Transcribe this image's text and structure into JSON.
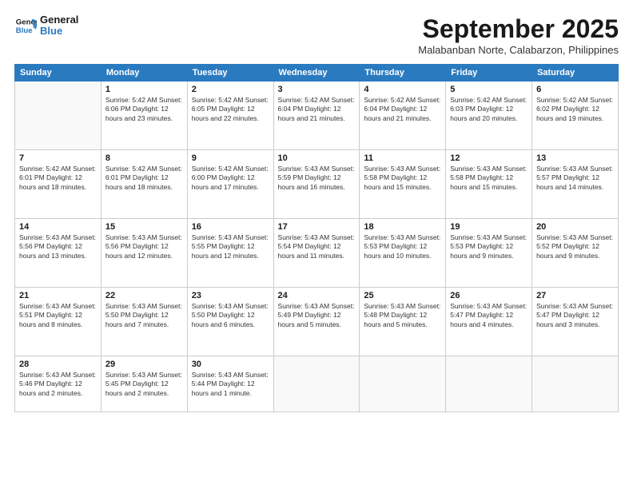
{
  "header": {
    "logo_line1": "General",
    "logo_line2": "Blue",
    "month_title": "September 2025",
    "location": "Malabanban Norte, Calabarzon, Philippines"
  },
  "days_of_week": [
    "Sunday",
    "Monday",
    "Tuesday",
    "Wednesday",
    "Thursday",
    "Friday",
    "Saturday"
  ],
  "weeks": [
    [
      {
        "day": "",
        "info": ""
      },
      {
        "day": "1",
        "info": "Sunrise: 5:42 AM\nSunset: 6:06 PM\nDaylight: 12 hours\nand 23 minutes."
      },
      {
        "day": "2",
        "info": "Sunrise: 5:42 AM\nSunset: 6:05 PM\nDaylight: 12 hours\nand 22 minutes."
      },
      {
        "day": "3",
        "info": "Sunrise: 5:42 AM\nSunset: 6:04 PM\nDaylight: 12 hours\nand 21 minutes."
      },
      {
        "day": "4",
        "info": "Sunrise: 5:42 AM\nSunset: 6:04 PM\nDaylight: 12 hours\nand 21 minutes."
      },
      {
        "day": "5",
        "info": "Sunrise: 5:42 AM\nSunset: 6:03 PM\nDaylight: 12 hours\nand 20 minutes."
      },
      {
        "day": "6",
        "info": "Sunrise: 5:42 AM\nSunset: 6:02 PM\nDaylight: 12 hours\nand 19 minutes."
      }
    ],
    [
      {
        "day": "7",
        "info": "Sunrise: 5:42 AM\nSunset: 6:01 PM\nDaylight: 12 hours\nand 18 minutes."
      },
      {
        "day": "8",
        "info": "Sunrise: 5:42 AM\nSunset: 6:01 PM\nDaylight: 12 hours\nand 18 minutes."
      },
      {
        "day": "9",
        "info": "Sunrise: 5:42 AM\nSunset: 6:00 PM\nDaylight: 12 hours\nand 17 minutes."
      },
      {
        "day": "10",
        "info": "Sunrise: 5:43 AM\nSunset: 5:59 PM\nDaylight: 12 hours\nand 16 minutes."
      },
      {
        "day": "11",
        "info": "Sunrise: 5:43 AM\nSunset: 5:58 PM\nDaylight: 12 hours\nand 15 minutes."
      },
      {
        "day": "12",
        "info": "Sunrise: 5:43 AM\nSunset: 5:58 PM\nDaylight: 12 hours\nand 15 minutes."
      },
      {
        "day": "13",
        "info": "Sunrise: 5:43 AM\nSunset: 5:57 PM\nDaylight: 12 hours\nand 14 minutes."
      }
    ],
    [
      {
        "day": "14",
        "info": "Sunrise: 5:43 AM\nSunset: 5:56 PM\nDaylight: 12 hours\nand 13 minutes."
      },
      {
        "day": "15",
        "info": "Sunrise: 5:43 AM\nSunset: 5:56 PM\nDaylight: 12 hours\nand 12 minutes."
      },
      {
        "day": "16",
        "info": "Sunrise: 5:43 AM\nSunset: 5:55 PM\nDaylight: 12 hours\nand 12 minutes."
      },
      {
        "day": "17",
        "info": "Sunrise: 5:43 AM\nSunset: 5:54 PM\nDaylight: 12 hours\nand 11 minutes."
      },
      {
        "day": "18",
        "info": "Sunrise: 5:43 AM\nSunset: 5:53 PM\nDaylight: 12 hours\nand 10 minutes."
      },
      {
        "day": "19",
        "info": "Sunrise: 5:43 AM\nSunset: 5:53 PM\nDaylight: 12 hours\nand 9 minutes."
      },
      {
        "day": "20",
        "info": "Sunrise: 5:43 AM\nSunset: 5:52 PM\nDaylight: 12 hours\nand 9 minutes."
      }
    ],
    [
      {
        "day": "21",
        "info": "Sunrise: 5:43 AM\nSunset: 5:51 PM\nDaylight: 12 hours\nand 8 minutes."
      },
      {
        "day": "22",
        "info": "Sunrise: 5:43 AM\nSunset: 5:50 PM\nDaylight: 12 hours\nand 7 minutes."
      },
      {
        "day": "23",
        "info": "Sunrise: 5:43 AM\nSunset: 5:50 PM\nDaylight: 12 hours\nand 6 minutes."
      },
      {
        "day": "24",
        "info": "Sunrise: 5:43 AM\nSunset: 5:49 PM\nDaylight: 12 hours\nand 5 minutes."
      },
      {
        "day": "25",
        "info": "Sunrise: 5:43 AM\nSunset: 5:48 PM\nDaylight: 12 hours\nand 5 minutes."
      },
      {
        "day": "26",
        "info": "Sunrise: 5:43 AM\nSunset: 5:47 PM\nDaylight: 12 hours\nand 4 minutes."
      },
      {
        "day": "27",
        "info": "Sunrise: 5:43 AM\nSunset: 5:47 PM\nDaylight: 12 hours\nand 3 minutes."
      }
    ],
    [
      {
        "day": "28",
        "info": "Sunrise: 5:43 AM\nSunset: 5:46 PM\nDaylight: 12 hours\nand 2 minutes."
      },
      {
        "day": "29",
        "info": "Sunrise: 5:43 AM\nSunset: 5:45 PM\nDaylight: 12 hours\nand 2 minutes."
      },
      {
        "day": "30",
        "info": "Sunrise: 5:43 AM\nSunset: 5:44 PM\nDaylight: 12 hours\nand 1 minute."
      },
      {
        "day": "",
        "info": ""
      },
      {
        "day": "",
        "info": ""
      },
      {
        "day": "",
        "info": ""
      },
      {
        "day": "",
        "info": ""
      }
    ]
  ]
}
